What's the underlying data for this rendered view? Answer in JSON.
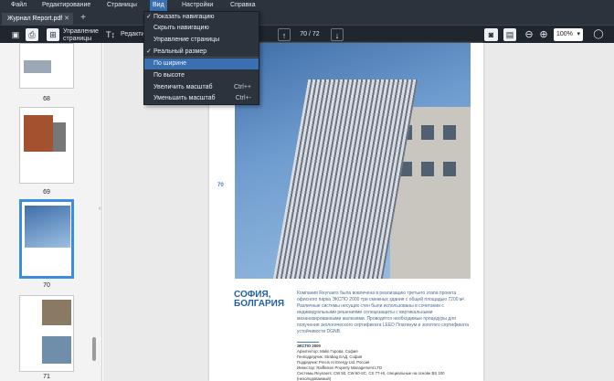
{
  "menu": {
    "file": "Файл",
    "edit": "Редактирование",
    "pages": "Страницы",
    "view": "Вид",
    "settings": "Настройки",
    "help": "Справка"
  },
  "tab": {
    "title": "Журнал Report.pdf",
    "close": "✕",
    "new": "+"
  },
  "toolbar": {
    "manage_pages": "Управление страницы",
    "edit_label": "Редакти",
    "page_indicator": "70 / 72",
    "zoom": "100%"
  },
  "view_menu": {
    "items": [
      {
        "label": "Показать навигацию",
        "checked": true,
        "shortcut": ""
      },
      {
        "label": "Скрыть навигацию",
        "checked": false,
        "shortcut": ""
      },
      {
        "label": "Управление страницы",
        "checked": false,
        "shortcut": ""
      },
      {
        "label": "Реальный размер",
        "checked": true,
        "shortcut": ""
      },
      {
        "label": "По ширине",
        "checked": false,
        "shortcut": "",
        "highlighted": true
      },
      {
        "label": "По высоте",
        "checked": false,
        "shortcut": ""
      },
      {
        "label": "Увеличить масштаб",
        "checked": false,
        "shortcut": "Ctrl++"
      },
      {
        "label": "Уменьшить масштаб",
        "checked": false,
        "shortcut": "Ctrl+-"
      }
    ]
  },
  "thumbnails": {
    "pages": [
      "68",
      "69",
      "70",
      "71"
    ],
    "selected": "70"
  },
  "document": {
    "page_number": "70",
    "title_line1": "СОФИЯ,",
    "title_line2": "БОЛГАРИЯ",
    "body": "Компания Reynaers была вовлечена в реализацию третьего этапа проекта офисного парка ЭКСПО 2000 три смежных здания с общей площадью 7200 м². Различные системы несущих стен были использованы в сочетании с индивидуальными решениями солнцезащиты с вертикальными механизированными жалюзями. Проводятся необходимые процедуры для получения экологического сертификата LEED Платинум и золотого сертификата устойчивости DGNB.",
    "credits": [
      "ЭКСПО 2000",
      "Архитектор: Malin Горова, София",
      "Генподрядчик: Strabag ЕАД, София",
      "Подрядчик: Precis AI Energy Ltd, Россия",
      "Инвестор: Raiffeisen Property Management LTD",
      "Системы Reynaers: CW 50, CW 60-SC, CS 77-HI, специальные на основе BS 100 (нехолодоваемый)"
    ]
  },
  "colors": {
    "menubar": "#2b333d",
    "toolbar": "#1f262e",
    "accent": "#3a6fb0",
    "selection": "#3b8de0",
    "title_blue": "#1f5fa2"
  }
}
